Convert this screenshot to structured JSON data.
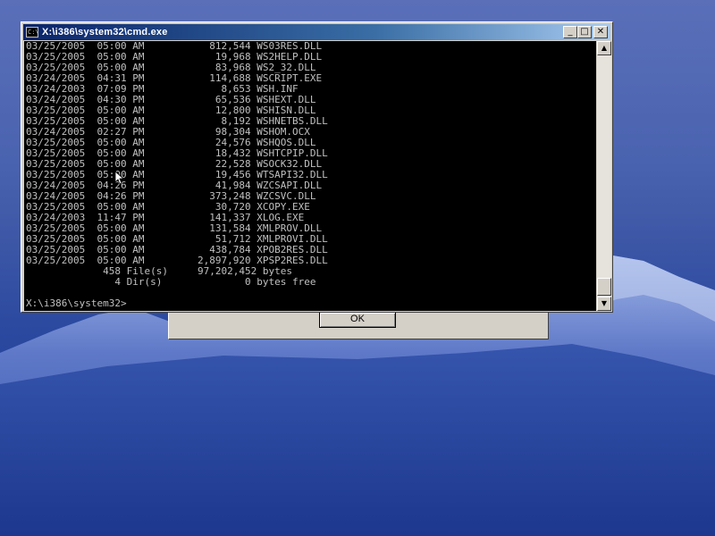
{
  "window": {
    "title": "X:\\i386\\system32\\cmd.exe",
    "icon_text": "C:\\",
    "minimize_glyph": "_",
    "maximize_glyph": "□",
    "close_glyph": "✕"
  },
  "console": {
    "lines": [
      "03/25/2005  05:00 AM           812,544 WS03RES.DLL",
      "03/25/2005  05:00 AM            19,968 WS2HELP.DLL",
      "03/25/2005  05:00 AM            83,968 WS2_32.DLL",
      "03/24/2005  04:31 PM           114,688 WSCRIPT.EXE",
      "03/24/2003  07:09 PM             8,653 WSH.INF",
      "03/24/2005  04:30 PM            65,536 WSHEXT.DLL",
      "03/25/2005  05:00 AM            12,800 WSHISN.DLL",
      "03/25/2005  05:00 AM             8,192 WSHNETBS.DLL",
      "03/24/2005  02:27 PM            98,304 WSHOM.OCX",
      "03/25/2005  05:00 AM            24,576 WSHQOS.DLL",
      "03/25/2005  05:00 AM            18,432 WSHTCPIP.DLL",
      "03/25/2005  05:00 AM            22,528 WSOCK32.DLL",
      "03/25/2005  05:00 AM            19,456 WTSAPI32.DLL",
      "03/24/2005  04:26 PM            41,984 WZCSAPI.DLL",
      "03/24/2005  04:26 PM           373,248 WZCSVC.DLL",
      "03/25/2005  05:00 AM            30,720 XCOPY.EXE",
      "03/24/2003  11:47 PM           141,337 XLOG.EXE",
      "03/25/2005  05:00 AM           131,584 XMLPROV.DLL",
      "03/25/2005  05:00 AM            51,712 XMLPROVI.DLL",
      "03/25/2005  05:00 AM           438,784 XPOB2RES.DLL",
      "03/25/2005  05:00 AM         2,897,920 XPSP2RES.DLL",
      "             458 File(s)     97,202,452 bytes",
      "               4 Dir(s)              0 bytes free",
      "",
      "X:\\i386\\system32>"
    ]
  },
  "dialog": {
    "ok_label": "OK"
  }
}
